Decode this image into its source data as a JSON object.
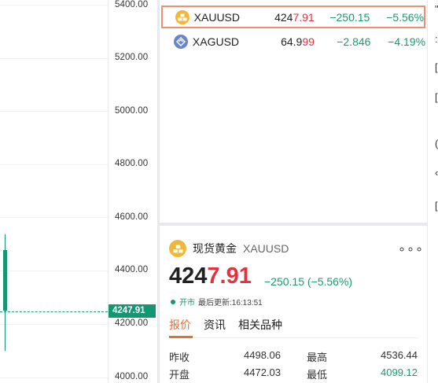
{
  "chart": {
    "y_ticks": [
      "5400.00",
      "5200.00",
      "5000.00",
      "4800.00",
      "4600.00",
      "4400.00",
      "4200.00",
      "4000.00"
    ],
    "current_price_tag": "4247.91",
    "colors": {
      "down": "#139672",
      "grid": "#eef0f2"
    }
  },
  "watchlist": [
    {
      "symbol": "XAUUSD",
      "icon": "gold-coin-icon",
      "price_prefix": "424",
      "price_suffix": "7.91",
      "change": "−250.15",
      "pct": "−5.56%"
    },
    {
      "symbol": "XAGUSD",
      "icon": "silver-coin-icon",
      "price_prefix": "64.9",
      "price_suffix": "99",
      "change": "−2.846",
      "pct": "−4.19%"
    }
  ],
  "detail": {
    "name": "现货黄金",
    "code": "XAUUSD",
    "more": "∘∘∘",
    "price_prefix": "424",
    "price_suffix": "7.91",
    "change": "−250.15 (−5.56%)",
    "status_open": "开市",
    "status_updated": "最后更新:16:13:51",
    "tabs": [
      "报价",
      "资讯",
      "相关品种"
    ],
    "stats": {
      "prev_close_label": "昨收",
      "prev_close": "4498.06",
      "high_label": "最高",
      "high": "4536.44",
      "open_label": "开盘",
      "open": "4472.03",
      "low_label": "最低",
      "low": "4099.12"
    }
  },
  "strip_glyphs": [
    "\"",
    ":",
    "[",
    "[",
    "(",
    "‹",
    "["
  ]
}
